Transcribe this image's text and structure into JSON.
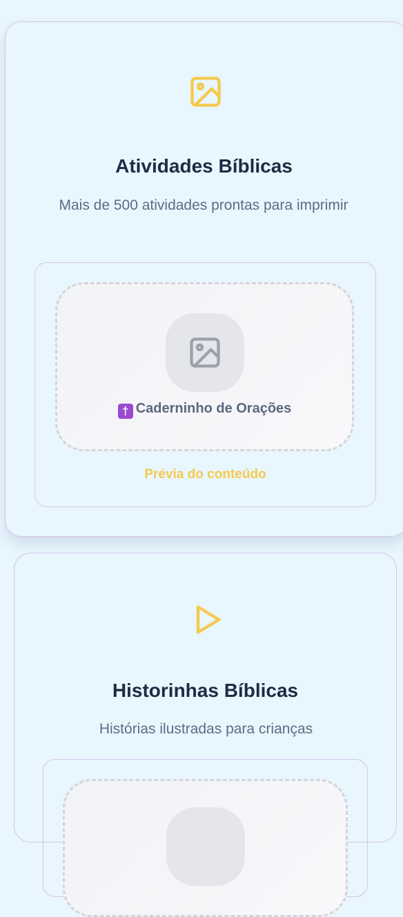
{
  "cards": [
    {
      "icon": "image-icon",
      "title": "Atividades Bíblicas",
      "description": "Mais de 500 atividades prontas para imprimir",
      "preview": {
        "placeholder_icon": "image-icon",
        "emoji": "✝️",
        "item_label": "Caderninho de Orações",
        "caption": "Prévia do conteúdo"
      }
    },
    {
      "icon": "play-icon",
      "title": "Historinhas Bíblicas",
      "description": "Histórias ilustradas para crianças"
    }
  ],
  "colors": {
    "background": "#e8f6fd",
    "accent": "#f6c94e",
    "title": "#1e2b44",
    "muted_text": "#5d6c86",
    "card_border": "#d6c6ea"
  }
}
